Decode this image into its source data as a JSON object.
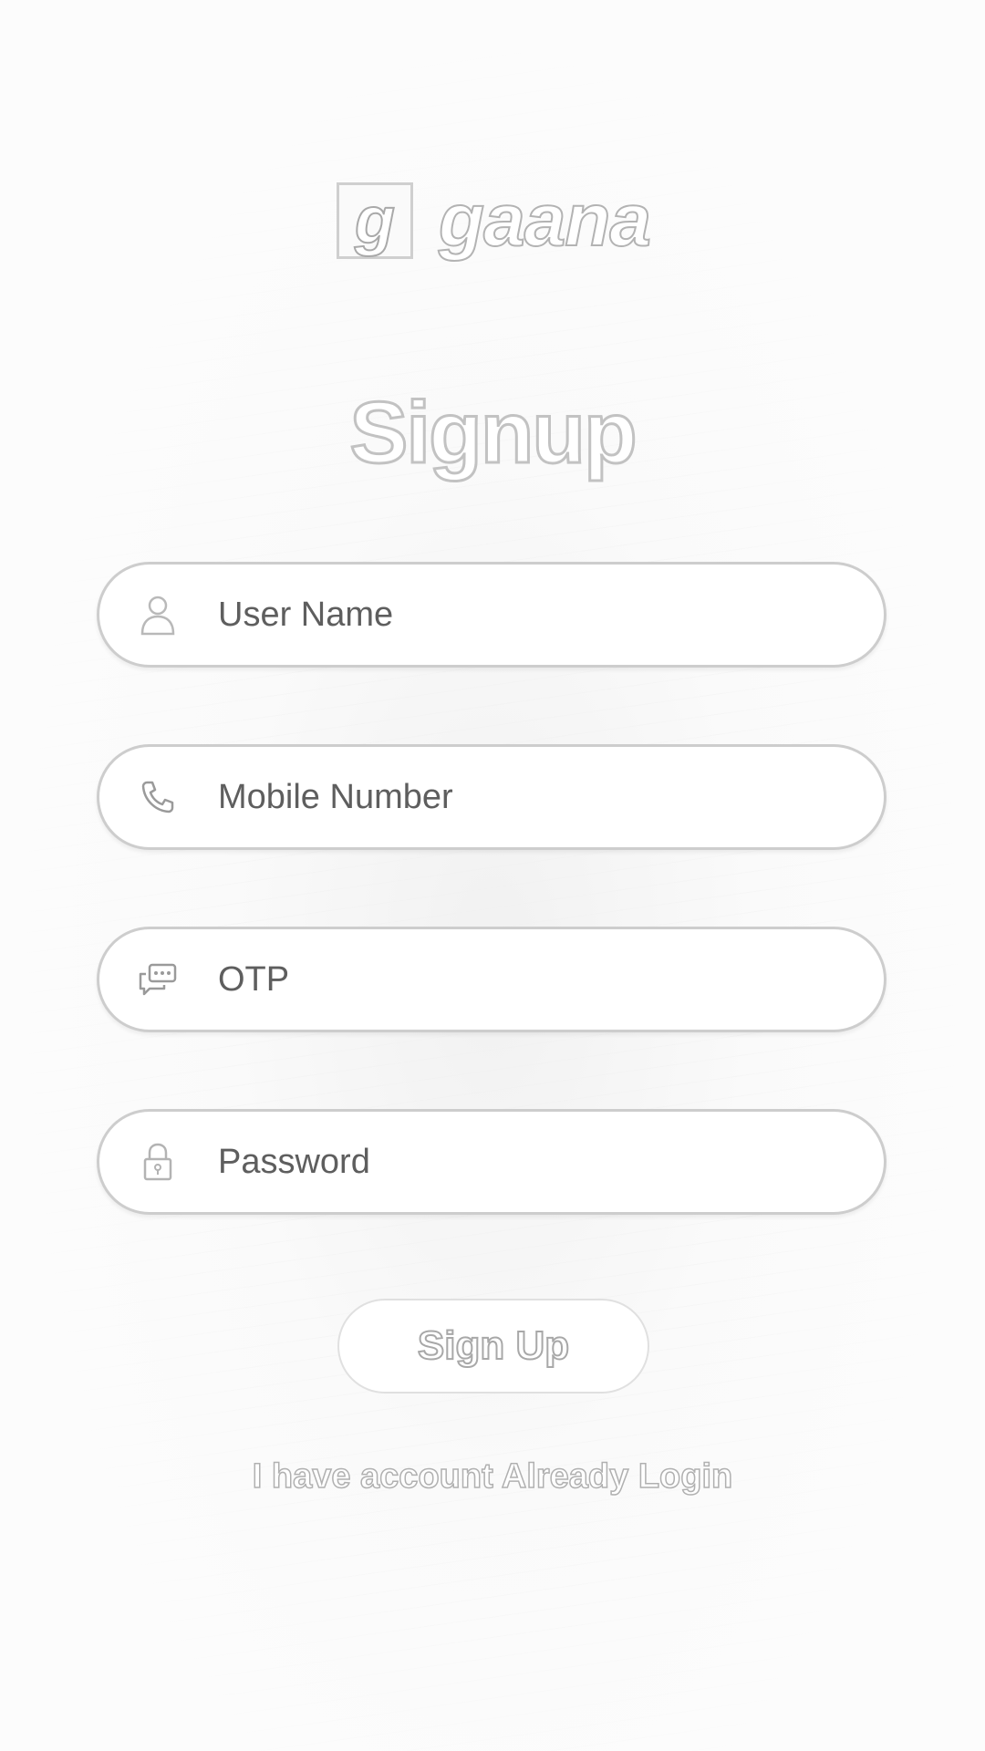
{
  "logo": {
    "glyph": "g",
    "wordmark": "gaana"
  },
  "title": "Signup",
  "form": {
    "username": {
      "placeholder": "User Name",
      "value": "",
      "icon": "user-icon"
    },
    "mobile": {
      "placeholder": "Mobile Number",
      "value": "",
      "icon": "phone-icon"
    },
    "otp": {
      "placeholder": "OTP",
      "value": "",
      "icon": "chat-bubbles-icon"
    },
    "password": {
      "placeholder": "Password",
      "value": "",
      "icon": "lock-icon"
    }
  },
  "signup_button": {
    "label": "Sign Up"
  },
  "login_link": {
    "label": "I have account Already Login"
  },
  "colors": {
    "background": "#fbfbfb",
    "field_border": "#cdcdcd",
    "placeholder": "#5e5e5e",
    "outline_text": "#b3b3b3"
  }
}
